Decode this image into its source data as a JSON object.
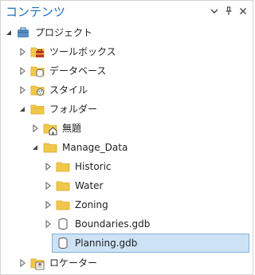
{
  "pane": {
    "title": "コンテンツ",
    "header_buttons": [
      {
        "name": "dropdown-icon",
        "glyph": "▾"
      },
      {
        "name": "pin-icon",
        "glyph": "pin"
      },
      {
        "name": "close-icon",
        "glyph": "×"
      }
    ]
  },
  "tree": {
    "project": "プロジェクト",
    "toolbox": "ツールボックス",
    "database": "データベース",
    "style": "スタイル",
    "folder": "フォルダー",
    "untitled": "無題",
    "manage_data": "Manage_Data",
    "historic": "Historic",
    "water": "Water",
    "zoning": "Zoning",
    "boundaries": "Boundaries.gdb",
    "planning": "Planning.gdb",
    "locator": "ロケーター"
  },
  "colors": {
    "title": "#1c6fc0",
    "selection_fill": "#cde3f5",
    "selection_border": "#7fb0dc",
    "folder": "#f2c84b",
    "folder_dark": "#d9a925"
  }
}
